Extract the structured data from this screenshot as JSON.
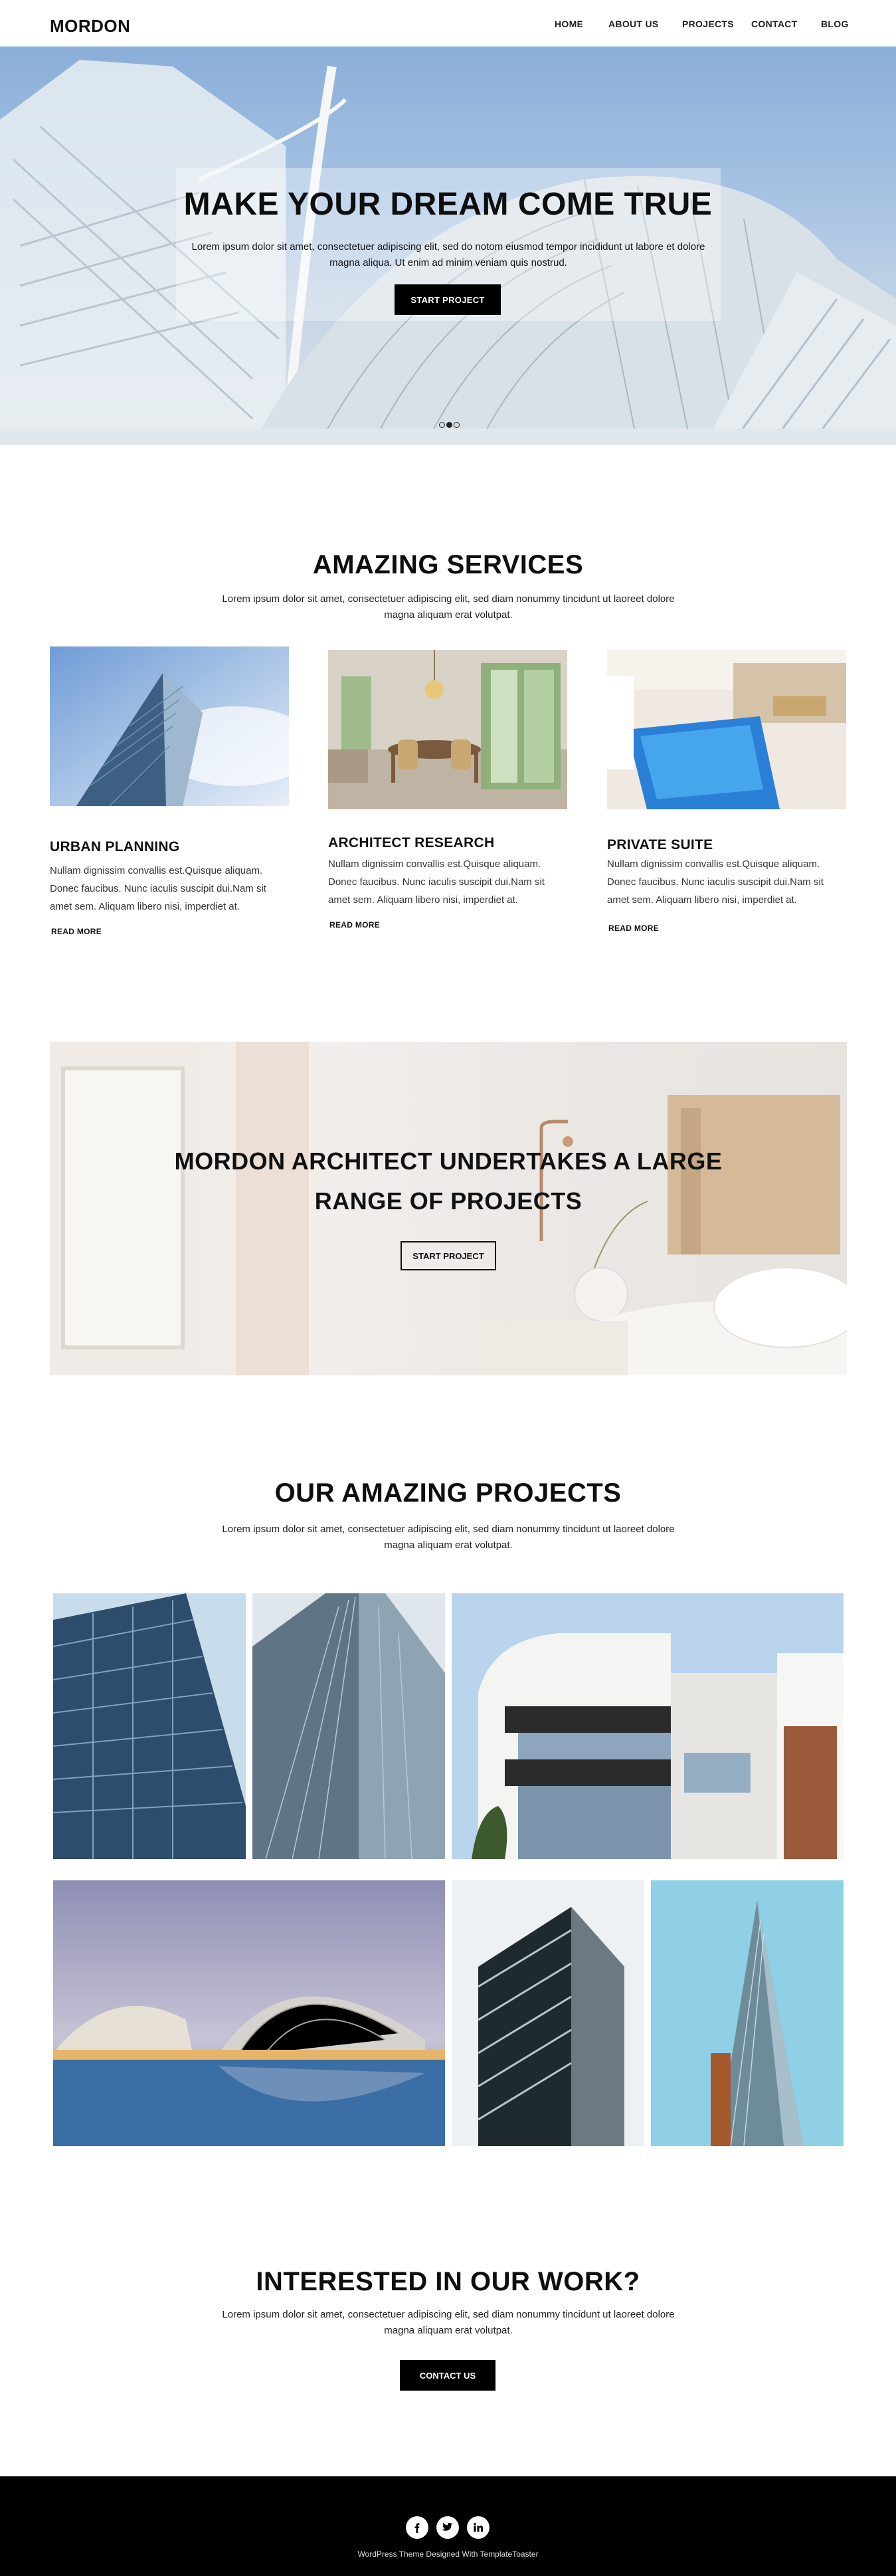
{
  "header": {
    "logo": "MORDON",
    "nav": [
      "HOME",
      "ABOUT US",
      "PROJECTS",
      "CONTACT",
      "BLOG"
    ]
  },
  "hero": {
    "title": "MAKE YOUR DREAM COME TRUE",
    "subtitle": "Lorem ipsum dolor sit amet, consectetuer adipiscing elit, sed do notom eiusmod tempor incididunt ut labore et dolore magna aliqua. Ut enim ad minim veniam quis nostrud.",
    "button": "START PROJECT",
    "slides": 3,
    "active_slide": 2
  },
  "services": {
    "title": "AMAZING SERVICES",
    "subtitle": "Lorem ipsum dolor sit amet, consectetuer adipiscing elit, sed diam nonummy tincidunt ut laoreet dolore magna aliquam erat volutpat.",
    "items": [
      {
        "title": "URBAN PLANNING",
        "text": "Nullam dignissim convallis est.Quisque aliquam. Donec faucibus. Nunc iaculis suscipit dui.Nam sit amet sem. Aliquam libero nisi, imperdiet at.",
        "link": "READ MORE"
      },
      {
        "title": "ARCHITECT RESEARCH",
        "text": "Nullam dignissim convallis est.Quisque aliquam. Donec faucibus. Nunc iaculis suscipit dui.Nam sit amet sem. Aliquam libero nisi, imperdiet at.",
        "link": "READ MORE"
      },
      {
        "title": "PRIVATE SUITE",
        "text": "Nullam dignissim convallis est.Quisque aliquam. Donec faucibus. Nunc iaculis suscipit dui.Nam sit amet sem. Aliquam libero nisi, imperdiet at.",
        "link": "READ MORE"
      }
    ]
  },
  "banner": {
    "title_line1": "MORDON ARCHITECT UNDERTAKES A LARGE",
    "title_line2": "RANGE OF PROJECTS",
    "button": "START PROJECT"
  },
  "projects": {
    "title": "OUR AMAZING PROJECTS",
    "subtitle": "Lorem ipsum dolor sit amet, consectetuer adipiscing elit, sed diam nonummy tincidunt ut laoreet dolore magna aliquam erat volutpat."
  },
  "cta": {
    "title": "INTERESTED IN OUR WORK?",
    "subtitle": "Lorem ipsum dolor sit amet, consectetuer adipiscing elit, sed diam nonummy tincidunt ut laoreet dolore magna aliquam erat volutpat.",
    "button": "CONTACT US"
  },
  "footer": {
    "social_icons": [
      "facebook-icon",
      "twitter-icon",
      "linkedin-icon"
    ],
    "credit": "WordPress Theme Designed With TemplateToaster"
  }
}
